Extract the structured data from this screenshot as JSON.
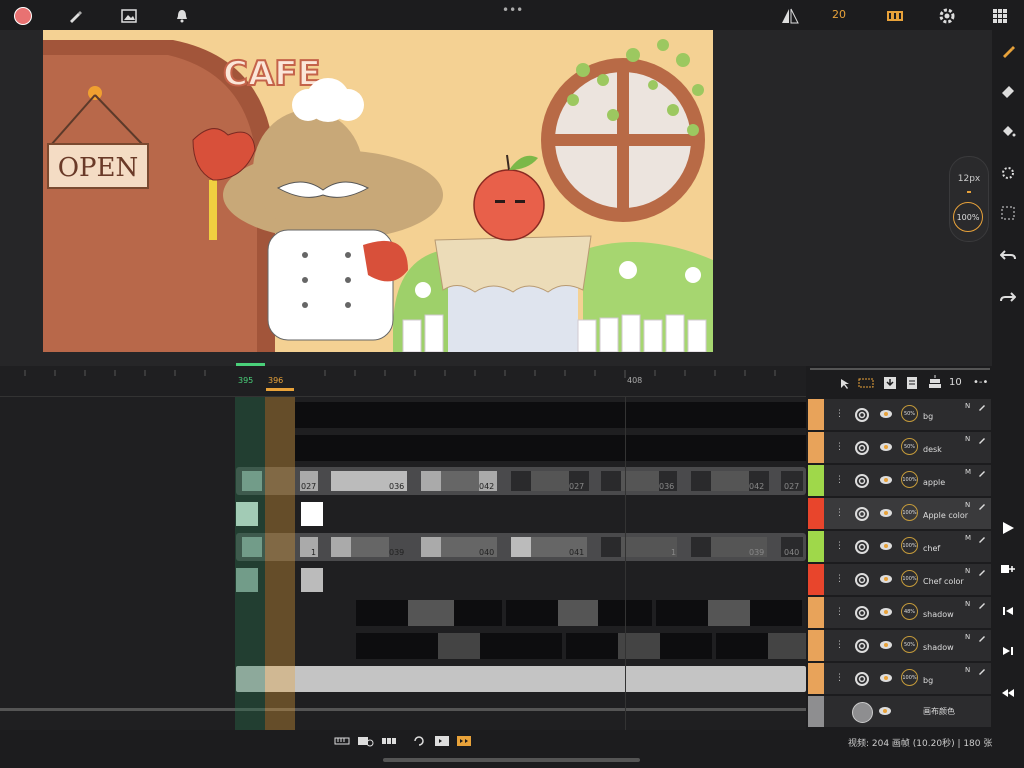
{
  "topbar": {
    "dots": "•••",
    "frame_rate": "20"
  },
  "brush": {
    "size": "12px",
    "opacity": "100%"
  },
  "artwork": {
    "sign_text": "OPEN",
    "cafe_text": "CAFE"
  },
  "ruler": {
    "start_marker": "395",
    "current_marker": "396",
    "mid_marker": "408"
  },
  "layer_toolbar": {
    "count": "10"
  },
  "rows": [
    {
      "cells": []
    },
    {
      "cells": []
    },
    {
      "cells": [
        "027",
        "036",
        "042",
        "027",
        "036",
        "042",
        "027"
      ]
    },
    {
      "cells": []
    },
    {
      "cells": [
        "1",
        "039",
        "040",
        "041",
        "1",
        "039",
        "040"
      ]
    },
    {
      "cells": []
    },
    {
      "cells": []
    },
    {
      "cells": []
    },
    {
      "cells": []
    }
  ],
  "layers": [
    {
      "name": "bg",
      "mode": "N",
      "opacity": "50%",
      "color": "#e8a35a"
    },
    {
      "name": "desk",
      "mode": "N",
      "opacity": "50%",
      "color": "#e8a35a"
    },
    {
      "name": "apple",
      "mode": "M",
      "opacity": "100%",
      "color": "#9fd84a"
    },
    {
      "name": "Apple color",
      "mode": "N",
      "opacity": "100%",
      "color": "#e8452c"
    },
    {
      "name": "chef",
      "mode": "M",
      "opacity": "100%",
      "color": "#9fd84a"
    },
    {
      "name": "Chef color",
      "mode": "N",
      "opacity": "100%",
      "color": "#e8452c"
    },
    {
      "name": "shadow",
      "mode": "N",
      "opacity": "48%",
      "color": "#e8a35a"
    },
    {
      "name": "shadow",
      "mode": "N",
      "opacity": "50%",
      "color": "#e8a35a"
    },
    {
      "name": "bg",
      "mode": "N",
      "opacity": "100%",
      "color": "#e8a35a"
    }
  ],
  "canvas_layer": {
    "name": "画布颜色"
  },
  "status": {
    "info": "视频: 204 画帧 (10.20秒) | 180 张"
  },
  "colors": {
    "accent": "#e8a23a",
    "record": "#e87272"
  }
}
